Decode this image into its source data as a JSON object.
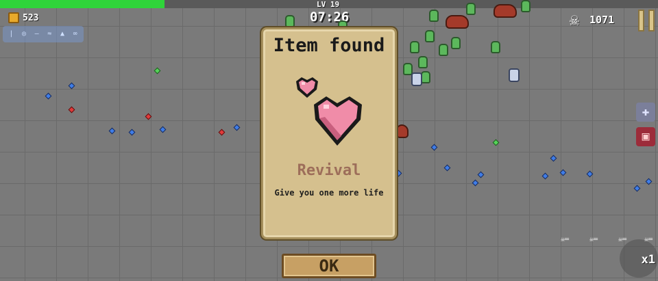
{
  "hud": {
    "xp_progress": 0.25,
    "coins": "523",
    "level": "LV 19",
    "timer": "07:26",
    "kills": "1071",
    "speed": "x1",
    "weapon_icons": [
      "sword-icon",
      "ring-icon",
      "spear-icon",
      "chain-icon",
      "potion-icon",
      "bones-icon"
    ]
  },
  "dialog": {
    "title": "Item found",
    "item_name": "Revival",
    "item_description": "Give you one more life",
    "item_icon": "hearts-icon",
    "button_label": "OK"
  },
  "colors": {
    "xp_fill": "#2fd43a",
    "panel": "#d5c08e",
    "item_name": "#9d6e5a",
    "heart": "#f08ca8"
  }
}
